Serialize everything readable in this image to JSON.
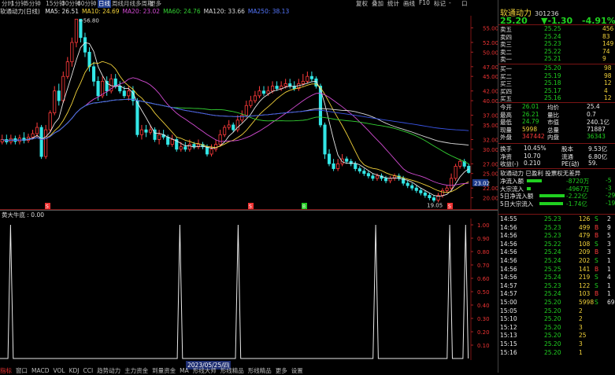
{
  "topbar": {
    "periods": [
      "分时",
      "1分钟",
      "5分钟",
      "15分钟",
      "30分钟",
      "60分钟",
      "日线",
      "周线",
      "月线",
      "多周期",
      "更多"
    ],
    "active_period": "日线",
    "right_tools": [
      "复权",
      "叠加",
      "统计",
      "画线",
      "F10",
      "标记",
      "-",
      "口"
    ]
  },
  "ma_legend": {
    "title": "软通动力(日线)",
    "items": [
      {
        "label": "MA5: 26.51",
        "color": "#e8e8e8"
      },
      {
        "label": "MA10: 24.69",
        "color": "#f3d33a"
      },
      {
        "label": "MA20: 23.02",
        "color": "#d24bd2"
      },
      {
        "label": "MA60: 24.76",
        "color": "#33d233"
      },
      {
        "label": "MA120: 33.66",
        "color": "#d8d8d8"
      },
      {
        "label": "MA250: 38.13",
        "color": "#5577ff"
      }
    ]
  },
  "indicator": {
    "name": "黄大牛底",
    "value": "0.00"
  },
  "date_label": "2023/05/25/四",
  "bottombar": {
    "items": [
      "指标",
      "窗口",
      "MACD",
      "VOL",
      "KDJ",
      "CCI",
      "趋势动力",
      "主力资金",
      "到量资金",
      "MA",
      "形线大师",
      "形线精品",
      "形线精品",
      "更多",
      "设置"
    ],
    "selected": "指标"
  },
  "chart_data": [
    {
      "type": "candlestick",
      "title": "软通动力(日线)",
      "ylim": [
        17.5,
        57.5
      ],
      "yticks": [
        "55.00",
        "52.00",
        "50.00",
        "47.00",
        "45.00",
        "42.00",
        "40.00",
        "37.00",
        "35.00",
        "32.00",
        "30.00",
        "27.00",
        "25.00",
        "22.00",
        "20.00"
      ],
      "current_price_label": "23.02",
      "annotations": [
        {
          "text": "56.80",
          "kind": "high"
        },
        {
          "text": "19.05",
          "kind": "low"
        }
      ],
      "markers": [
        "S",
        "S",
        "B",
        "S"
      ],
      "candles": [
        [
          31.5,
          32,
          33,
          31
        ],
        [
          32,
          31.5,
          33,
          31
        ],
        [
          31.5,
          32.2,
          33,
          31
        ],
        [
          32.2,
          31.6,
          32.8,
          31
        ],
        [
          31.6,
          32.3,
          33,
          31
        ],
        [
          32.3,
          31.8,
          33.5,
          31.2
        ],
        [
          31.8,
          32.5,
          33.2,
          31.3
        ],
        [
          32.5,
          33.2,
          34,
          32
        ],
        [
          33.2,
          34.5,
          35.5,
          32.5
        ],
        [
          34.5,
          28.5,
          35,
          28
        ],
        [
          28.5,
          34,
          35,
          28
        ],
        [
          34,
          37.5,
          38,
          33.5
        ],
        [
          37.5,
          42,
          43,
          37
        ],
        [
          42,
          40,
          43.5,
          39
        ],
        [
          40,
          45,
          46,
          39.5
        ],
        [
          45,
          48,
          49,
          44.5
        ],
        [
          48,
          52,
          53,
          47
        ],
        [
          52,
          56.8,
          56.8,
          51
        ],
        [
          56.8,
          53,
          56,
          52
        ],
        [
          53,
          50,
          54,
          49
        ],
        [
          50,
          47,
          51,
          46
        ],
        [
          47,
          44,
          48,
          43
        ],
        [
          44,
          41,
          45,
          40
        ],
        [
          41,
          44,
          45,
          40.5
        ],
        [
          44,
          42,
          45,
          41
        ],
        [
          42,
          44.5,
          45.5,
          41.5
        ],
        [
          44.5,
          43,
          45.5,
          42.5
        ],
        [
          43,
          42,
          44,
          41.5
        ],
        [
          42,
          41,
          43,
          40.5
        ],
        [
          41,
          42,
          43,
          40
        ],
        [
          42,
          40,
          43,
          39
        ],
        [
          40,
          33,
          40.5,
          32.5
        ],
        [
          33,
          34,
          35,
          32
        ],
        [
          34,
          33.5,
          35,
          32.5
        ],
        [
          33.5,
          34,
          35,
          33
        ],
        [
          34,
          32,
          34.5,
          31.5
        ],
        [
          32,
          33,
          34,
          31
        ],
        [
          33,
          32.5,
          34,
          32
        ],
        [
          32.5,
          31,
          33,
          30.5
        ],
        [
          31,
          32,
          33,
          30.5
        ],
        [
          32,
          30,
          32.5,
          29.5
        ],
        [
          30,
          30.5,
          31.5,
          29.5
        ],
        [
          30.5,
          30,
          31.5,
          29.5
        ],
        [
          30,
          31,
          32,
          29.5
        ],
        [
          31,
          30.5,
          31.5,
          30
        ],
        [
          30.5,
          31,
          32,
          30
        ],
        [
          31,
          30.5,
          31.5,
          30
        ],
        [
          30.5,
          29,
          31,
          28.5
        ],
        [
          29,
          30,
          31,
          28.5
        ],
        [
          30,
          31,
          32,
          29.5
        ],
        [
          31,
          33,
          34,
          30.5
        ],
        [
          33,
          34.5,
          35,
          32.5
        ],
        [
          34.5,
          35,
          36,
          34
        ],
        [
          35,
          34,
          35.5,
          33.5
        ],
        [
          34,
          36,
          37,
          33.5
        ],
        [
          36,
          37,
          38,
          35.5
        ],
        [
          37,
          39,
          40,
          36.5
        ],
        [
          39,
          40,
          41,
          38.5
        ],
        [
          40,
          41,
          42,
          39.5
        ],
        [
          41,
          42,
          43,
          40.5
        ],
        [
          42,
          41.5,
          43,
          41
        ],
        [
          41.5,
          42,
          43,
          41
        ],
        [
          42,
          43,
          44,
          41.5
        ],
        [
          43,
          42.5,
          44,
          42
        ],
        [
          42.5,
          43,
          44,
          42
        ],
        [
          43,
          43.5,
          44.5,
          42.5
        ],
        [
          43.5,
          43,
          44.5,
          42.5
        ],
        [
          43,
          42.5,
          44,
          42
        ],
        [
          42.5,
          43.5,
          44.5,
          42
        ],
        [
          43.5,
          44,
          45.5,
          43
        ],
        [
          44,
          45,
          46,
          43.5
        ],
        [
          45,
          44.5,
          46,
          44
        ],
        [
          44.5,
          43,
          45,
          42.5
        ],
        [
          43,
          35,
          43.5,
          34.5
        ],
        [
          35,
          29,
          35.5,
          28
        ],
        [
          29,
          27,
          30,
          26.5
        ],
        [
          27,
          26,
          28,
          25.5
        ],
        [
          26,
          27,
          28,
          25.5
        ],
        [
          27,
          28,
          29,
          26.5
        ],
        [
          28,
          27.5,
          28.5,
          27
        ],
        [
          27.5,
          27,
          28,
          26.5
        ],
        [
          27,
          26,
          27.5,
          25.5
        ],
        [
          26,
          25.5,
          26.5,
          25
        ],
        [
          25.5,
          25,
          26,
          24.5
        ],
        [
          25,
          24.5,
          25.5,
          24
        ],
        [
          24.5,
          24,
          25,
          23.5
        ],
        [
          24,
          24.5,
          25,
          23.5
        ],
        [
          24.5,
          24,
          25,
          23.5
        ],
        [
          24,
          23.5,
          24.5,
          23
        ],
        [
          23.5,
          24,
          24.5,
          23
        ],
        [
          24,
          24.5,
          25,
          23.5
        ],
        [
          24.5,
          24,
          25,
          23.5
        ],
        [
          24,
          23,
          24.5,
          22.5
        ],
        [
          23,
          22.5,
          23.5,
          22
        ],
        [
          22.5,
          22,
          23,
          21.5
        ],
        [
          22,
          21.5,
          22.5,
          21
        ],
        [
          21.5,
          21,
          22,
          20.5
        ],
        [
          21,
          20.5,
          21.5,
          20
        ],
        [
          20.5,
          20,
          21,
          19.5
        ],
        [
          20,
          19.5,
          20.5,
          19.05
        ],
        [
          19.5,
          20.5,
          21,
          19.05
        ],
        [
          20.5,
          21.5,
          22,
          20
        ],
        [
          21.5,
          22,
          22.5,
          21
        ],
        [
          22,
          24,
          25,
          21.5
        ],
        [
          24,
          26.5,
          27,
          23.5
        ],
        [
          26.5,
          27.5,
          28,
          26
        ],
        [
          27.5,
          26.5,
          28,
          26
        ],
        [
          26.5,
          25.2,
          27,
          25
        ]
      ],
      "ma_series": [
        {
          "name": "MA5",
          "color": "#e8e8e8"
        },
        {
          "name": "MA10",
          "color": "#f3d33a"
        },
        {
          "name": "MA20",
          "color": "#d24bd2"
        },
        {
          "name": "MA60",
          "color": "#33d233"
        },
        {
          "name": "MA120",
          "color": "#d8d8d8"
        },
        {
          "name": "MA250",
          "color": "#3a55e8"
        }
      ]
    },
    {
      "type": "line",
      "title": "黄大牛底",
      "ylim": [
        0,
        1
      ],
      "yticks": [
        "1.00",
        "0.90",
        "0.80",
        "0.70",
        "0.60",
        "0.50",
        "0.40",
        "0.30",
        "0.20",
        "0.10"
      ],
      "spikes_at": [
        4,
        68,
        90,
        142,
        170,
        176
      ],
      "length": 178
    }
  ],
  "quote": {
    "name": "软通动力",
    "code": "301236",
    "price": "25.20",
    "change": "▼-1.30",
    "pct": "-4.91%",
    "asks": [
      {
        "label": "卖五",
        "price": "25.25",
        "vol": "456"
      },
      {
        "label": "卖四",
        "price": "25.24",
        "vol": "83"
      },
      {
        "label": "卖三",
        "price": "25.23",
        "vol": "149"
      },
      {
        "label": "卖二",
        "price": "25.22",
        "vol": "74"
      },
      {
        "label": "卖一",
        "price": "25.21",
        "vol": "9"
      }
    ],
    "bids": [
      {
        "label": "买一",
        "price": "25.20",
        "vol": "98"
      },
      {
        "label": "买二",
        "price": "25.19",
        "vol": "98"
      },
      {
        "label": "买三",
        "price": "25.18",
        "vol": "12"
      },
      {
        "label": "买四",
        "price": "25.17",
        "vol": "4"
      },
      {
        "label": "买五",
        "price": "25.16",
        "vol": "12"
      }
    ],
    "stats": [
      {
        "l1": "今开",
        "v1": "26.01",
        "l2": "均价",
        "v2": "25.4"
      },
      {
        "l1": "最高",
        "v1": "26.21",
        "l2": "量比",
        "v2": "0.7"
      },
      {
        "l1": "最低",
        "v1": "24.79",
        "l2": "市值",
        "v2": "240.1亿"
      },
      {
        "l1": "现量",
        "v1": "5998",
        "l2": "总量",
        "v2": "71887"
      },
      {
        "l1": "外盘",
        "v1": "347442",
        "l2": "内盘",
        "v2": "36343"
      }
    ],
    "stats2": [
      {
        "l1": "换手",
        "v1": "10.45%",
        "l2": "股本",
        "v2": "9.53亿"
      },
      {
        "l1": "净资",
        "v1": "10.70",
        "l2": "流通",
        "v2": "6.80亿"
      },
      {
        "l1": "收益(-)",
        "v1": "0.210",
        "l2": "PE(动)",
        "v2": "59."
      }
    ],
    "info_line": "软通动力 已盈利 投票权无差异",
    "flows": [
      {
        "label": "净流入额",
        "value": "-8720万",
        "extra": "-5"
      },
      {
        "label": "大宗流入",
        "value": "-4967万",
        "extra": "-3"
      },
      {
        "label": "5日净流入额",
        "value": "-2.22亿",
        "extra": "-29"
      },
      {
        "label": "5日大宗流入",
        "value": "-1.74亿",
        "extra": "-19"
      }
    ],
    "ticks": [
      {
        "t": "14:55",
        "p": "25.23",
        "v": "126",
        "bs": "S",
        "n": "2"
      },
      {
        "t": "14:56",
        "p": "25.23",
        "v": "499",
        "bs": "B",
        "n": "9"
      },
      {
        "t": "14:56",
        "p": "25.23",
        "v": "479",
        "bs": "B",
        "n": "5"
      },
      {
        "t": "14:56",
        "p": "25.22",
        "v": "108",
        "bs": "S",
        "n": "3"
      },
      {
        "t": "14:56",
        "p": "25.24",
        "v": "209",
        "bs": "B",
        "n": "3"
      },
      {
        "t": "14:56",
        "p": "25.24",
        "v": "202",
        "bs": "S",
        "n": "1"
      },
      {
        "t": "14:56",
        "p": "25.25",
        "v": "141",
        "bs": "B",
        "n": "1"
      },
      {
        "t": "14:56",
        "p": "25.24",
        "v": "219",
        "bs": "S",
        "n": "4"
      },
      {
        "t": "14:57",
        "p": "25.23",
        "v": "122",
        "bs": "S",
        "n": "1"
      },
      {
        "t": "14:57",
        "p": "25.24",
        "v": "103",
        "bs": "B",
        "n": "1"
      },
      {
        "t": "15:00",
        "p": "25.20",
        "v": "5998",
        "bs": "S",
        "n": "69"
      },
      {
        "t": "15:05",
        "p": "25.20",
        "v": "2",
        "bs": "",
        "n": ""
      },
      {
        "t": "15:10",
        "p": "25.20",
        "v": "2",
        "bs": "",
        "n": ""
      },
      {
        "t": "15:12",
        "p": "25.20",
        "v": "3",
        "bs": "",
        "n": ""
      },
      {
        "t": "15:13",
        "p": "25.20",
        "v": "25",
        "bs": "",
        "n": ""
      },
      {
        "t": "15:15",
        "p": "25.20",
        "v": "3",
        "bs": "",
        "n": ""
      },
      {
        "t": "15:16",
        "p": "25.20",
        "v": "1",
        "bs": "",
        "n": ""
      }
    ]
  }
}
